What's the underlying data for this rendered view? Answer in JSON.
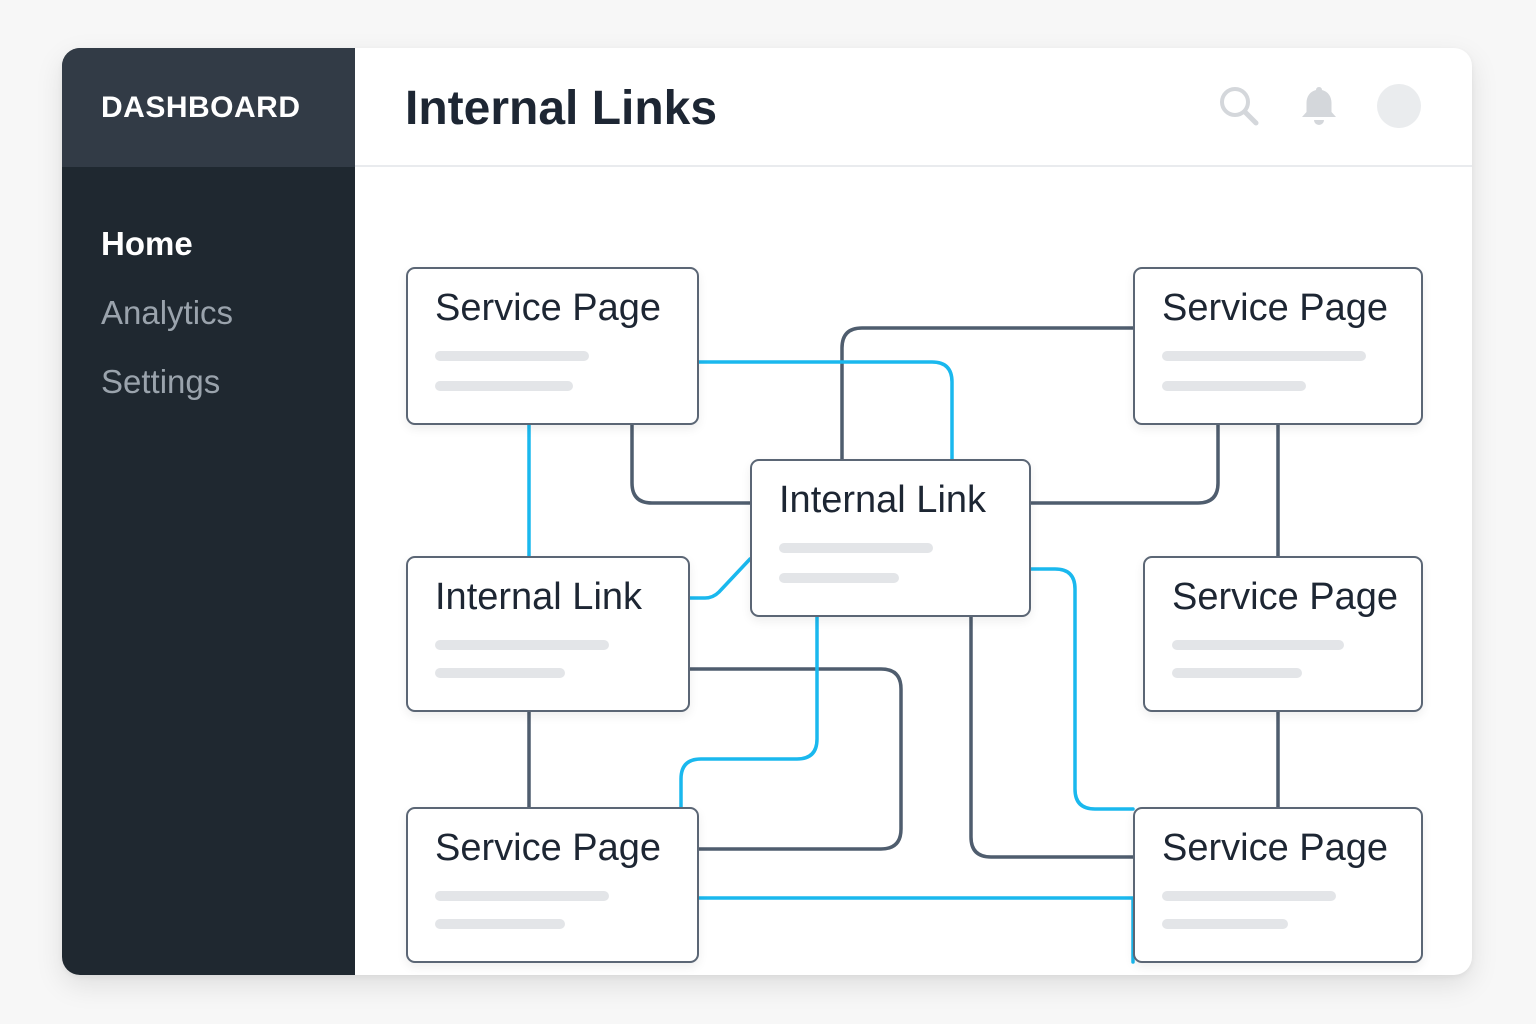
{
  "sidebar": {
    "brand": "DASHBOARD",
    "items": [
      {
        "label": "Home",
        "active": true
      },
      {
        "label": "Analytics",
        "active": false
      },
      {
        "label": "Settings",
        "active": false
      }
    ]
  },
  "header": {
    "title": "Internal Links",
    "icons": [
      "search-icon",
      "bell-icon",
      "avatar"
    ]
  },
  "nodes": {
    "service_top_left": "Service Page",
    "service_top_right": "Service Page",
    "internal_center": "Internal Link",
    "internal_left": "Internal Link",
    "service_mid_right": "Service Page",
    "service_bottom_left": "Service Page",
    "service_bottom_right": "Service Page"
  },
  "colors": {
    "sidebar_bg": "#1f2830",
    "brand_bg": "#323b46",
    "link_blue": "#1ab8ee",
    "link_gray": "#4f5d6e",
    "card_border": "#5b6675"
  }
}
